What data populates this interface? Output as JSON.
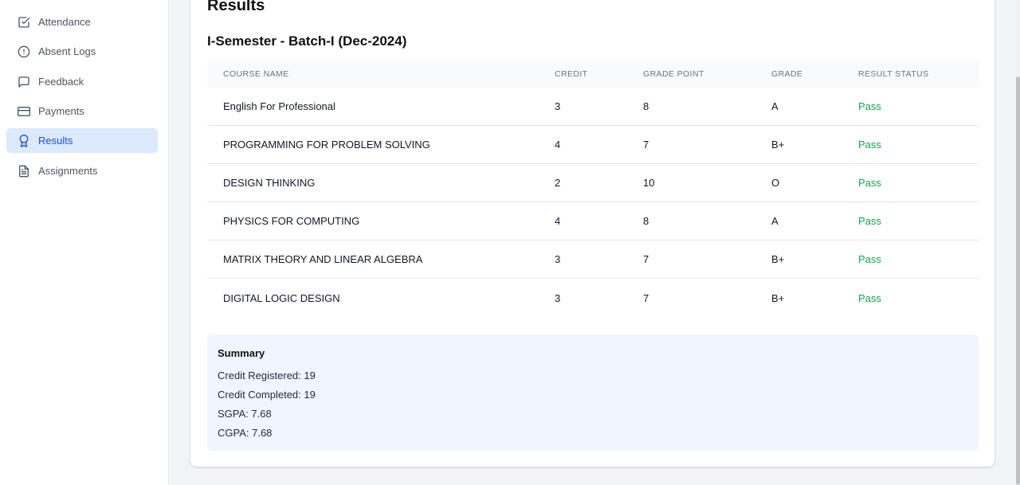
{
  "sidebar": {
    "items": [
      {
        "label": "Attendance",
        "icon": "checkbox-icon",
        "active": false
      },
      {
        "label": "Absent Logs",
        "icon": "alert-circle-icon",
        "active": false
      },
      {
        "label": "Feedback",
        "icon": "message-square-icon",
        "active": false
      },
      {
        "label": "Payments",
        "icon": "credit-card-icon",
        "active": false
      },
      {
        "label": "Results",
        "icon": "award-icon",
        "active": true
      },
      {
        "label": "Assignments",
        "icon": "file-text-icon",
        "active": false
      }
    ]
  },
  "page": {
    "title": "Results",
    "semester_title": "I-Semester - Batch-I (Dec-2024)"
  },
  "table": {
    "headers": [
      "COURSE NAME",
      "CREDIT",
      "GRADE POINT",
      "GRADE",
      "RESULT STATUS"
    ],
    "rows": [
      {
        "course": "English For Professional",
        "credit": "3",
        "grade_point": "8",
        "grade": "A",
        "status": "Pass"
      },
      {
        "course": "PROGRAMMING FOR PROBLEM SOLVING",
        "credit": "4",
        "grade_point": "7",
        "grade": "B+",
        "status": "Pass"
      },
      {
        "course": "DESIGN THINKING",
        "credit": "2",
        "grade_point": "10",
        "grade": "O",
        "status": "Pass"
      },
      {
        "course": "PHYSICS FOR COMPUTING",
        "credit": "4",
        "grade_point": "8",
        "grade": "A",
        "status": "Pass"
      },
      {
        "course": "MATRIX THEORY AND LINEAR ALGEBRA",
        "credit": "3",
        "grade_point": "7",
        "grade": "B+",
        "status": "Pass"
      },
      {
        "course": "DIGITAL LOGIC DESIGN",
        "credit": "3",
        "grade_point": "7",
        "grade": "B+",
        "status": "Pass"
      }
    ]
  },
  "summary": {
    "title": "Summary",
    "credit_registered": "Credit Registered: 19",
    "credit_completed": "Credit Completed: 19",
    "sgpa": "SGPA: 7.68",
    "cgpa": "CGPA: 7.68"
  },
  "colors": {
    "active_bg": "#dbeafe",
    "active_text": "#1d4ed8",
    "pass_color": "#16a34a",
    "summary_bg": "#eff6ff"
  }
}
